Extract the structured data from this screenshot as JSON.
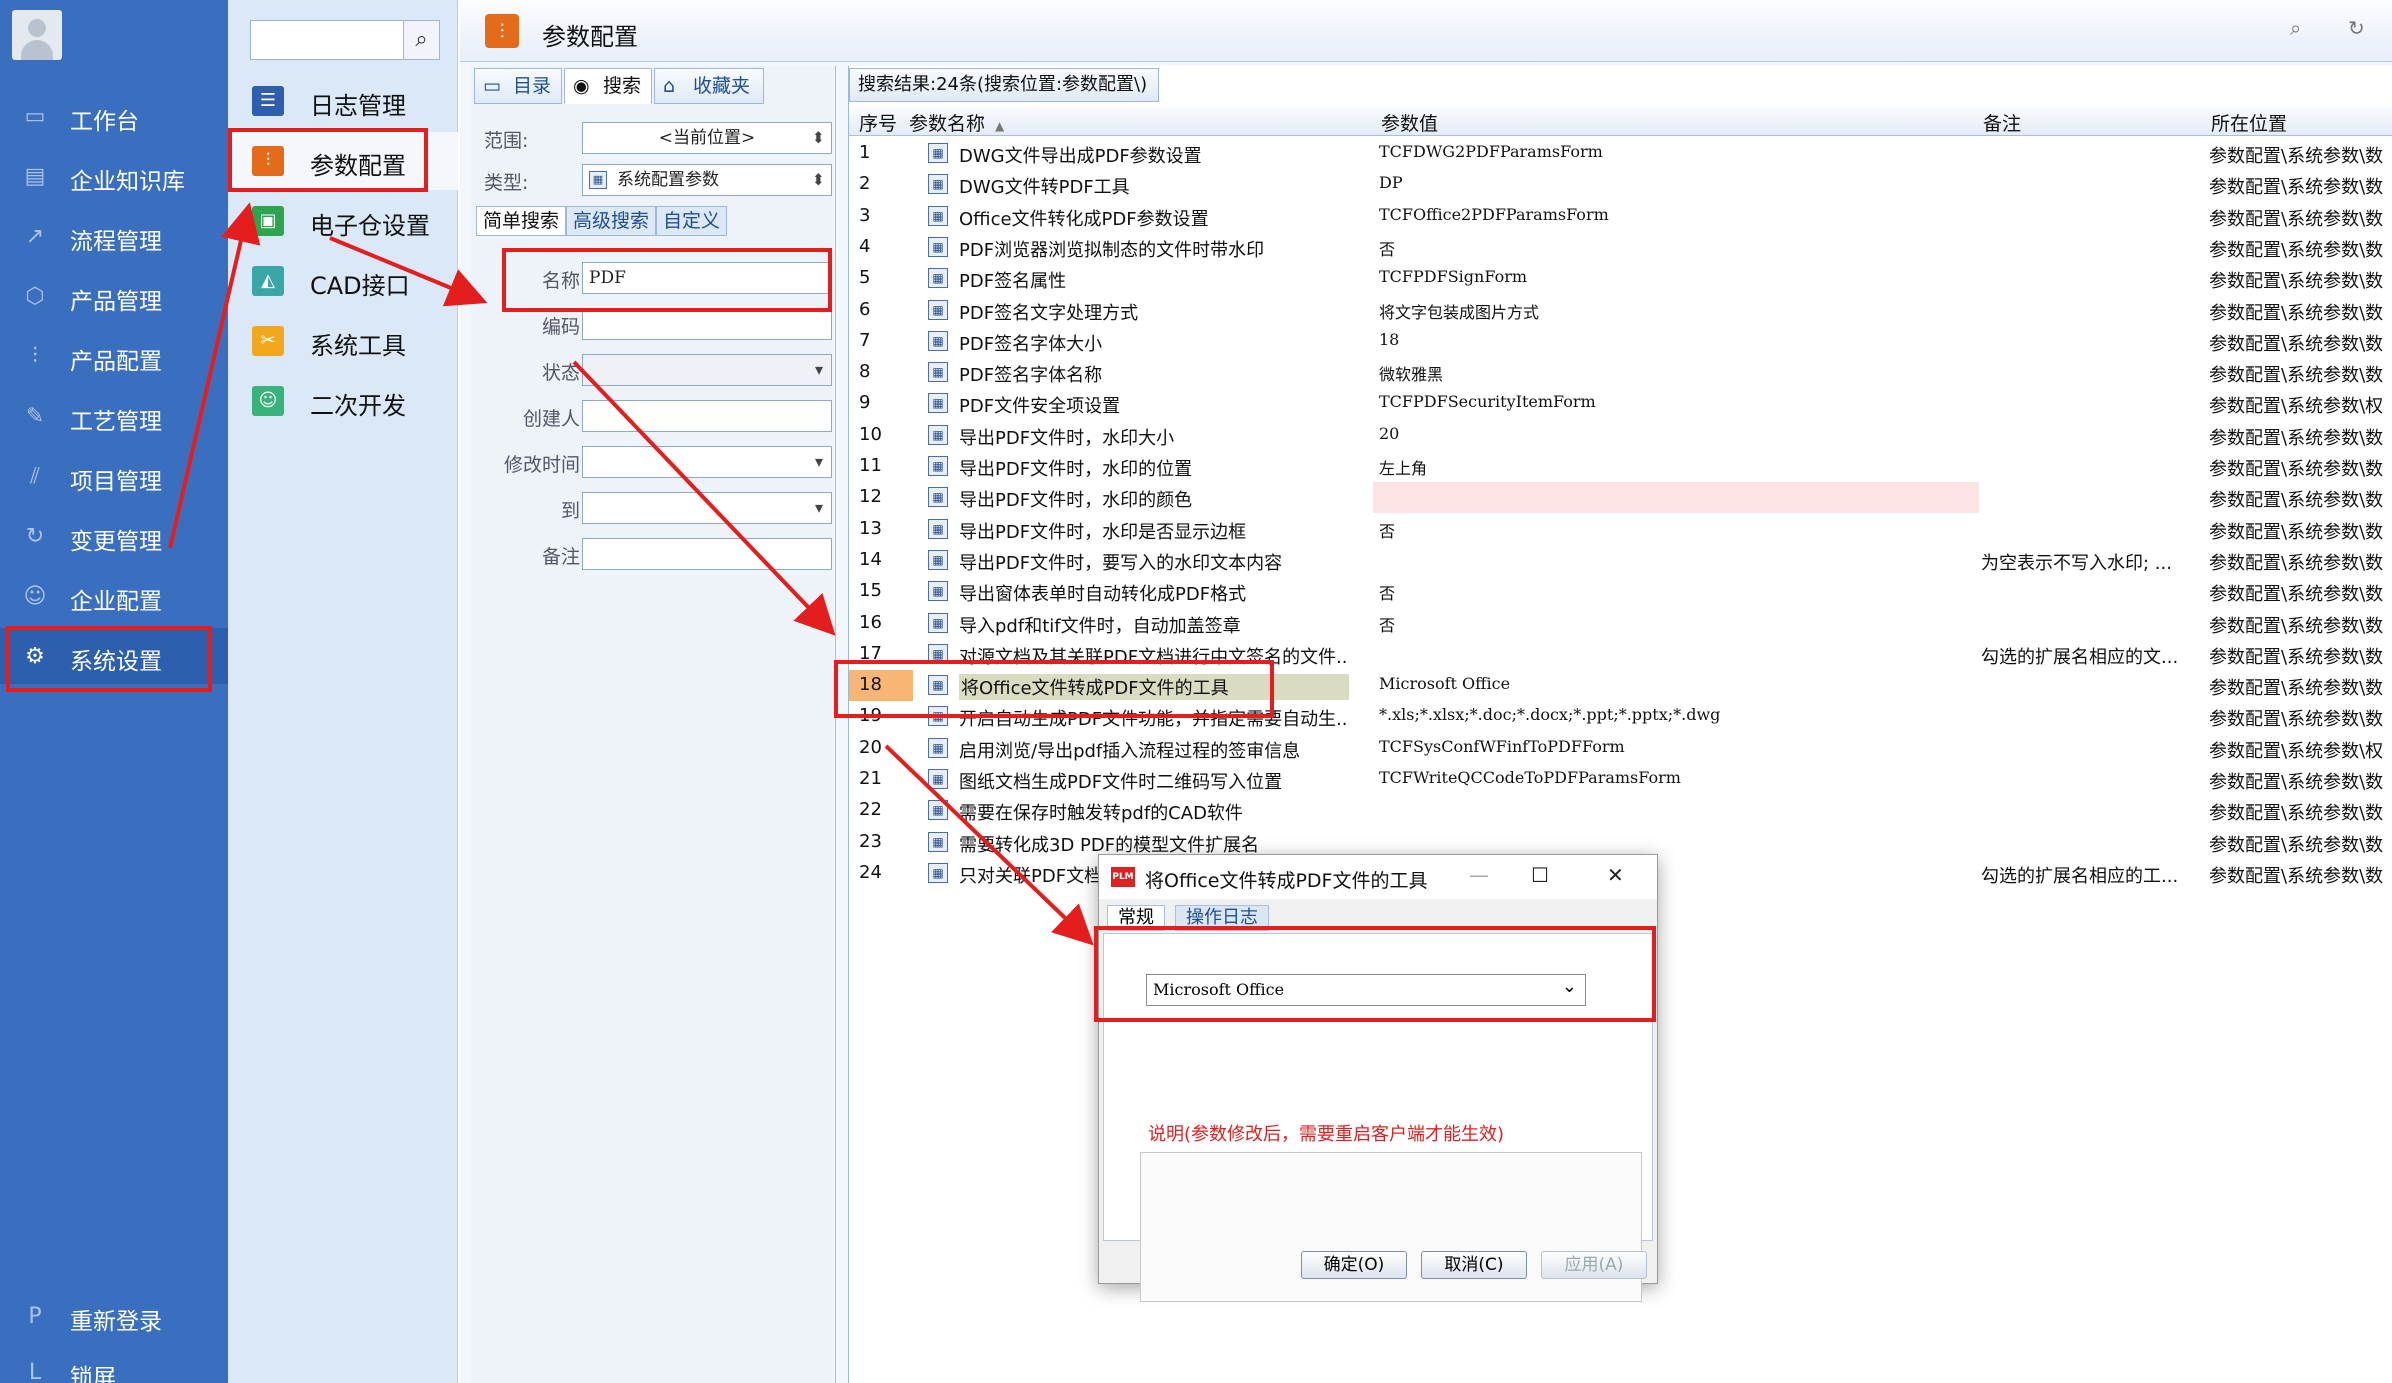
{
  "nav": {
    "items": [
      {
        "label": "工作台",
        "icon": "monitor-icon"
      },
      {
        "label": "企业知识库",
        "icon": "book-icon"
      },
      {
        "label": "流程管理",
        "icon": "flow-icon"
      },
      {
        "label": "产品管理",
        "icon": "cube-icon"
      },
      {
        "label": "产品配置",
        "icon": "sliders-icon"
      },
      {
        "label": "工艺管理",
        "icon": "wrench-icon"
      },
      {
        "label": "项目管理",
        "icon": "chart-icon"
      },
      {
        "label": "变更管理",
        "icon": "refresh-icon"
      },
      {
        "label": "企业配置",
        "icon": "users-icon"
      },
      {
        "label": "系统设置",
        "icon": "gear-icon"
      }
    ],
    "bottom": [
      {
        "label": "重新登录",
        "icon": "P"
      },
      {
        "label": "锁屏",
        "icon": "L"
      }
    ]
  },
  "sub": {
    "items": [
      {
        "label": "日志管理",
        "icon": "log-icon",
        "color": "#2d5fae"
      },
      {
        "label": "参数配置",
        "icon": "params-icon",
        "color": "#e36b1a"
      },
      {
        "label": "电子仓设置",
        "icon": "warehouse-icon",
        "color": "#2ea44f"
      },
      {
        "label": "CAD接口",
        "icon": "cad-icon",
        "color": "#3aa6a6"
      },
      {
        "label": "系统工具",
        "icon": "tools-icon",
        "color": "#f2a81d"
      },
      {
        "label": "二次开发",
        "icon": "dev-icon",
        "color": "#3ab37a"
      }
    ]
  },
  "header": {
    "title": "参数配置"
  },
  "left_panel": {
    "tabs": [
      "目录",
      "搜索",
      "收藏夹"
    ],
    "scope_label": "范围:",
    "scope_value": "<当前位置>",
    "type_label": "类型:",
    "type_value": "系统配置参数",
    "search_tabs": [
      "简单搜索",
      "高级搜索",
      "自定义"
    ],
    "fields": [
      {
        "label": "名称",
        "value": "PDF"
      },
      {
        "label": "编码",
        "value": ""
      },
      {
        "label": "状态",
        "value": ""
      },
      {
        "label": "创建人",
        "value": ""
      },
      {
        "label": "修改时间",
        "value": ""
      },
      {
        "label": "到",
        "value": ""
      },
      {
        "label": "备注",
        "value": ""
      }
    ]
  },
  "results": {
    "header": "搜索结果:24条(搜索位置:参数配置\\)",
    "columns": [
      "序号",
      "参数名称",
      "参数值",
      "备注",
      "所在位置"
    ],
    "rows": [
      {
        "no": "1",
        "name": "DWG文件导出成PDF参数设置",
        "value": "TCFDWG2PDFParamsForm",
        "note": "",
        "loc": "参数配置\\系统参数\\数"
      },
      {
        "no": "2",
        "name": "DWG文件转PDF工具",
        "value": "DP",
        "note": "",
        "loc": "参数配置\\系统参数\\数"
      },
      {
        "no": "3",
        "name": "Office文件转化成PDF参数设置",
        "value": "TCFOffice2PDFParamsForm",
        "note": "",
        "loc": "参数配置\\系统参数\\数"
      },
      {
        "no": "4",
        "name": "PDF浏览器浏览拟制态的文件时带水印",
        "value": "否",
        "note": "",
        "loc": "参数配置\\系统参数\\数"
      },
      {
        "no": "5",
        "name": "PDF签名属性",
        "value": "TCFPDFSignForm",
        "note": "",
        "loc": "参数配置\\系统参数\\数"
      },
      {
        "no": "6",
        "name": "PDF签名文字处理方式",
        "value": "将文字包装成图片方式",
        "note": "",
        "loc": "参数配置\\系统参数\\数"
      },
      {
        "no": "7",
        "name": "PDF签名字体大小",
        "value": "18",
        "note": "",
        "loc": "参数配置\\系统参数\\数"
      },
      {
        "no": "8",
        "name": "PDF签名字体名称",
        "value": "微软雅黑",
        "note": "",
        "loc": "参数配置\\系统参数\\数"
      },
      {
        "no": "9",
        "name": "PDF文件安全项设置",
        "value": "TCFPDFSecurityItemForm",
        "note": "",
        "loc": "参数配置\\系统参数\\权"
      },
      {
        "no": "10",
        "name": "导出PDF文件时，水印大小",
        "value": "20",
        "note": "",
        "loc": "参数配置\\系统参数\\数"
      },
      {
        "no": "11",
        "name": "导出PDF文件时，水印的位置",
        "value": "左上角",
        "note": "",
        "loc": "参数配置\\系统参数\\数"
      },
      {
        "no": "12",
        "name": "导出PDF文件时，水印的颜色",
        "value": "",
        "note": "",
        "loc": "参数配置\\系统参数\\数"
      },
      {
        "no": "13",
        "name": "导出PDF文件时，水印是否显示边框",
        "value": "否",
        "note": "",
        "loc": "参数配置\\系统参数\\数"
      },
      {
        "no": "14",
        "name": "导出PDF文件时，要写入的水印文本内容",
        "value": "",
        "note": "为空表示不写入水印; ...",
        "loc": "参数配置\\系统参数\\数"
      },
      {
        "no": "15",
        "name": "导出窗体表单时自动转化成PDF格式",
        "value": "否",
        "note": "",
        "loc": "参数配置\\系统参数\\数"
      },
      {
        "no": "16",
        "name": "导入pdf和tif文件时，自动加盖签章",
        "value": "否",
        "note": "",
        "loc": "参数配置\\系统参数\\数"
      },
      {
        "no": "17",
        "name": "对源文档及其关联PDF文档进行中文签名的文件...",
        "value": "",
        "note": "勾选的扩展名相应的文...",
        "loc": "参数配置\\系统参数\\数"
      },
      {
        "no": "18",
        "name": "将Office文件转成PDF文件的工具",
        "value": "Microsoft Office",
        "note": "",
        "loc": "参数配置\\系统参数\\数"
      },
      {
        "no": "19",
        "name": "开启自动生成PDF文件功能，并指定需要自动生...",
        "value": "*.xls;*.xlsx;*.doc;*.docx;*.ppt;*.pptx;*.dwg",
        "note": "",
        "loc": "参数配置\\系统参数\\数"
      },
      {
        "no": "20",
        "name": "启用浏览/导出pdf插入流程过程的签审信息",
        "value": "TCFSysConfWFinfToPDFForm",
        "note": "",
        "loc": "参数配置\\系统参数\\权"
      },
      {
        "no": "21",
        "name": "图纸文档生成PDF文件时二维码写入位置",
        "value": "TCFWriteQCCodeToPDFParamsForm",
        "note": "",
        "loc": "参数配置\\系统参数\\数"
      },
      {
        "no": "22",
        "name": "需要在保存时触发转pdf的CAD软件",
        "value": "",
        "note": "",
        "loc": "参数配置\\系统参数\\数"
      },
      {
        "no": "23",
        "name": "需要转化成3D PDF的模型文件扩展名",
        "value": "",
        "note": "",
        "loc": "参数配置\\系统参数\\数"
      },
      {
        "no": "24",
        "name": "只对关联PDF文档",
        "value": "",
        "note": "勾选的扩展名相应的工...",
        "loc": "参数配置\\系统参数\\数"
      }
    ]
  },
  "dialog": {
    "logo": "PLM",
    "title": "将Office文件转成PDF文件的工具",
    "tabs": [
      "常规",
      "操作日志"
    ],
    "value": "Microsoft Office",
    "hint": "说明(参数修改后，需要重启客户端才能生效)",
    "ok": "确定(O)",
    "cancel": "取消(C)",
    "apply": "应用(A)"
  },
  "colors": {
    "nav_bg": "#3a6fc0",
    "accent": "#e36b1a",
    "annotation": "#e41d1d"
  }
}
